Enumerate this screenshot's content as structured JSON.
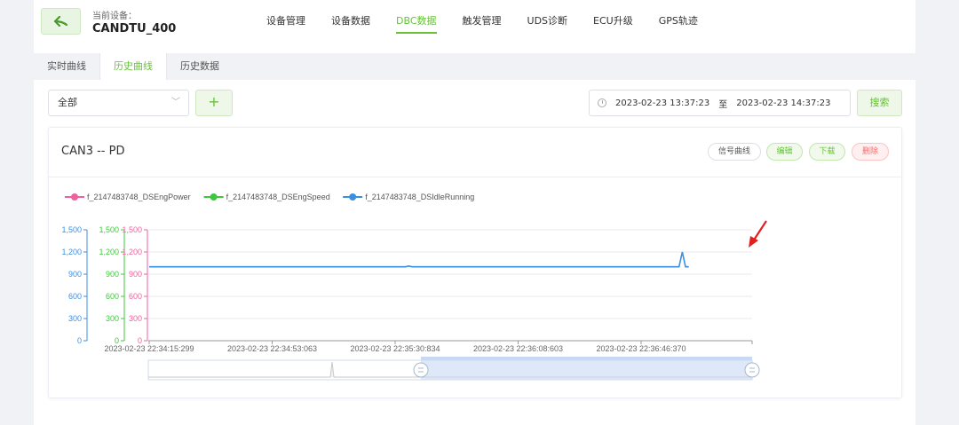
{
  "header": {
    "current_device_label": "当前设备：",
    "device_name": "CANDTU_400",
    "nav": [
      {
        "label": "设备管理",
        "active": false
      },
      {
        "label": "设备数据",
        "active": false
      },
      {
        "label": "DBC数据",
        "active": true
      },
      {
        "label": "触发管理",
        "active": false
      },
      {
        "label": "UDS诊断",
        "active": false
      },
      {
        "label": "ECU升级",
        "active": false
      },
      {
        "label": "GPS轨迹",
        "active": false
      }
    ]
  },
  "subtabs": [
    {
      "label": "实时曲线",
      "active": false
    },
    {
      "label": "历史曲线",
      "active": true
    },
    {
      "label": "历史数据",
      "active": false
    }
  ],
  "toolbar": {
    "select_value": "全部",
    "add_label": "+",
    "date_start": "2023-02-23 13:37:23",
    "date_sep": "至",
    "date_end": "2023-02-23 14:37:23",
    "search_label": "搜索"
  },
  "panel": {
    "title": "CAN3 -- PD",
    "actions": {
      "signal": "信号曲线",
      "edit": "编辑",
      "download": "下载",
      "delete": "删除"
    }
  },
  "colors": {
    "accent": "#67c23a",
    "danger": "#f56c6c"
  },
  "chart_data": {
    "type": "line",
    "grid": true,
    "legend_position": "top-left",
    "series": [
      {
        "name": "f_2147483748_DSEngPower",
        "color": "#f0609e",
        "values": []
      },
      {
        "name": "f_2147483748_DSEngSpeed",
        "color": "#3bc93b",
        "values": []
      },
      {
        "name": "f_2147483748_DSIdleRunning",
        "color": "#3b8fe0",
        "x": [
          "2023-02-23 22:34:15:299",
          "2023-02-23 22:35:34:000",
          "2023-02-23 22:35:35:000",
          "2023-02-23 22:35:36:000",
          "2023-02-23 22:36:58:000",
          "2023-02-23 22:36:59:000",
          "2023-02-23 22:37:00:000",
          "2023-02-23 22:37:01:000"
        ],
        "values": [
          1000,
          1000,
          1010,
          1000,
          1000,
          1200,
          1000,
          1000
        ]
      }
    ],
    "y_axes": [
      {
        "ylim": [
          0,
          1500
        ],
        "ticks": [
          "0",
          "300",
          "600",
          "900",
          "1,200",
          "1,500"
        ],
        "color": "#3b8fe0"
      },
      {
        "ylim": [
          0,
          1500
        ],
        "ticks": [
          "0",
          "300",
          "600",
          "900",
          "1,200",
          "1,500"
        ],
        "color": "#3bc93b"
      },
      {
        "ylim": [
          0,
          1500
        ],
        "ticks": [
          "0",
          "300",
          "600",
          "900",
          "1,200",
          "1,500"
        ],
        "color": "#f0609e"
      }
    ],
    "x_tick_labels": [
      "2023-02-23 22:34:15:299",
      "2023-02-23 22:34:53:063",
      "2023-02-23 22:35:30:834",
      "2023-02-23 22:36:08:603",
      "2023-02-23 22:36:46:370"
    ],
    "zoom_range": [
      0.45,
      1.0
    ]
  }
}
